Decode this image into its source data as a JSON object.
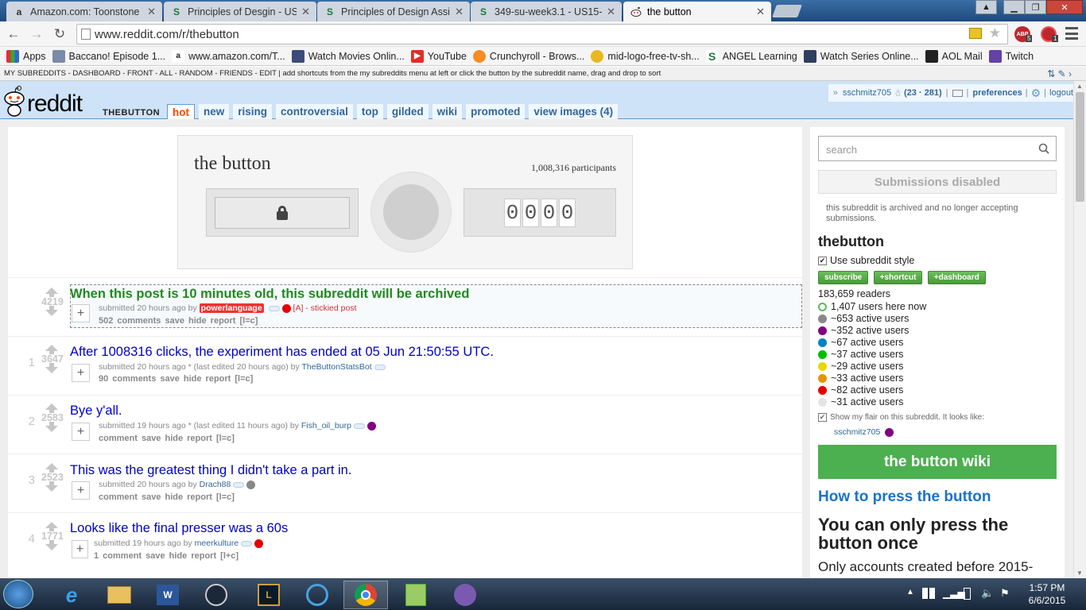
{
  "browser": {
    "tabs": [
      {
        "favicon": "amazon-icon",
        "label": "Amazon.com: Toonstone"
      },
      {
        "favicon": "s-icon",
        "label": "Principles of Desgin - US1"
      },
      {
        "favicon": "s-icon",
        "label": "Principles of Design Assig"
      },
      {
        "favicon": "s-icon",
        "label": "349-su-week3.1 - US15-T("
      },
      {
        "favicon": "reddit-icon",
        "label": "the button"
      }
    ],
    "url": "www.reddit.com/r/thebutton",
    "bookmarks": [
      {
        "icon": "apps-icon",
        "label": "Apps"
      },
      {
        "icon": "page-icon",
        "label": "Baccano! Episode 1..."
      },
      {
        "icon": "amazon-icon",
        "label": "www.amazon.com/T..."
      },
      {
        "icon": "film-icon",
        "label": "Watch Movies Onlin..."
      },
      {
        "icon": "youtube-icon",
        "label": "YouTube"
      },
      {
        "icon": "crunchyroll-icon",
        "label": "Crunchyroll - Brows..."
      },
      {
        "icon": "logo-icon",
        "label": "mid-logo-free-tv-sh..."
      },
      {
        "icon": "s-icon",
        "label": "ANGEL Learning"
      },
      {
        "icon": "film-icon",
        "label": "Watch Series Online..."
      },
      {
        "icon": "aol-icon",
        "label": "AOL Mail"
      },
      {
        "icon": "twitch-icon",
        "label": "Twitch"
      }
    ],
    "ext_badges": {
      "abp": "5",
      "other": "1"
    }
  },
  "srbar": {
    "text": "MY SUBREDDITS - DASHBOARD - FRONT - ALL - RANDOM - FRIENDS - EDIT  |  add shortcuts from the my subreddits menu at left or click the button by the subreddit name, drag and drop to sort"
  },
  "header": {
    "logo": "reddit",
    "subreddit": "THEBUTTON",
    "tabs": [
      "hot",
      "new",
      "rising",
      "controversial",
      "top",
      "gilded",
      "wiki",
      "promoted",
      "view images (4)"
    ],
    "user": "sschmitz705",
    "karma": "(23 · 281)",
    "preferences": "preferences",
    "logout": "logout"
  },
  "button_widget": {
    "title": "the button",
    "participants": "1,008,316 participants",
    "timer": [
      "0",
      "0",
      "0",
      "0"
    ]
  },
  "posts": [
    {
      "rank": "",
      "score": "4219",
      "title": "When this post is 10 minutes old, this subreddit will be archived",
      "tagline_pre": "submitted 20 hours ago by",
      "author": "powerlanguage",
      "tagline_post": "[A] - stickied post",
      "buttons": "502 comments   save   hide   report   [l=c]"
    },
    {
      "rank": "1",
      "score": "3647",
      "title": "After 1008316 clicks, the experiment has ended at 05 Jun 21:50:55 UTC.",
      "tagline_pre": "submitted 20 hours ago * (last edited 20 hours ago) by",
      "author": "TheButtonStatsBot",
      "tagline_post": "",
      "buttons": "90 comments   save   hide   report   [l=c]"
    },
    {
      "rank": "2",
      "score": "2583",
      "title": "Bye y'all.",
      "tagline_pre": "submitted 19 hours ago * (last edited 11 hours ago) by",
      "author": "Fish_oil_burp",
      "tagline_post": "",
      "buttons": "comment   save   hide   report   [l=c]"
    },
    {
      "rank": "3",
      "score": "2523",
      "title": "This was the greatest thing I didn't take a part in.",
      "tagline_pre": "submitted 20 hours ago by",
      "author": "Drach88",
      "tagline_post": "",
      "buttons": "comment   save   hide   report   [l=c]"
    },
    {
      "rank": "4",
      "score": "1771",
      "title": "Looks like the final presser was a 60s",
      "tagline_pre": "submitted 19 hours ago by",
      "author": "meerkulture",
      "tagline_post": "",
      "buttons": "1 comment   save   hide   report   [l+c]"
    }
  ],
  "sidebar": {
    "search_placeholder": "search",
    "submissions": "Submissions disabled",
    "archived_note": "this subreddit is archived and no longer accepting submissions.",
    "name": "thebutton",
    "use_style": "Use subreddit style",
    "btn_subscribe": "subscribe",
    "btn_shortcut": "+shortcut",
    "btn_dashboard": "+dashboard",
    "readers": "183,659 readers",
    "here_now": "1,407 users here now",
    "active": [
      {
        "color": "#888888",
        "label": "~653 active users"
      },
      {
        "color": "#820080",
        "label": "~352 active users"
      },
      {
        "color": "#0083c7",
        "label": "~67 active users"
      },
      {
        "color": "#02be01",
        "label": "~37 active users"
      },
      {
        "color": "#e5d900",
        "label": "~29 active users"
      },
      {
        "color": "#e59500",
        "label": "~33 active users"
      },
      {
        "color": "#e50000",
        "label": "~82 active users"
      },
      {
        "color": "#e4e4e4",
        "label": "~31 active users"
      }
    ],
    "show_flair": "Show my flair on this subreddit. It looks like:",
    "flair_user": "sschmitz705",
    "wiki": "the button wiki",
    "howto": "How to press the button",
    "once": "You can only press the button once",
    "only_accounts": "Only accounts created before 2015-"
  },
  "taskbar": {
    "time": "1:57 PM",
    "date": "6/6/2015"
  },
  "colors": {
    "accent": "#ff4500",
    "header": "#cee3f8",
    "link": "#0000cc",
    "sticky": "#228822",
    "green": "#4caf50"
  }
}
